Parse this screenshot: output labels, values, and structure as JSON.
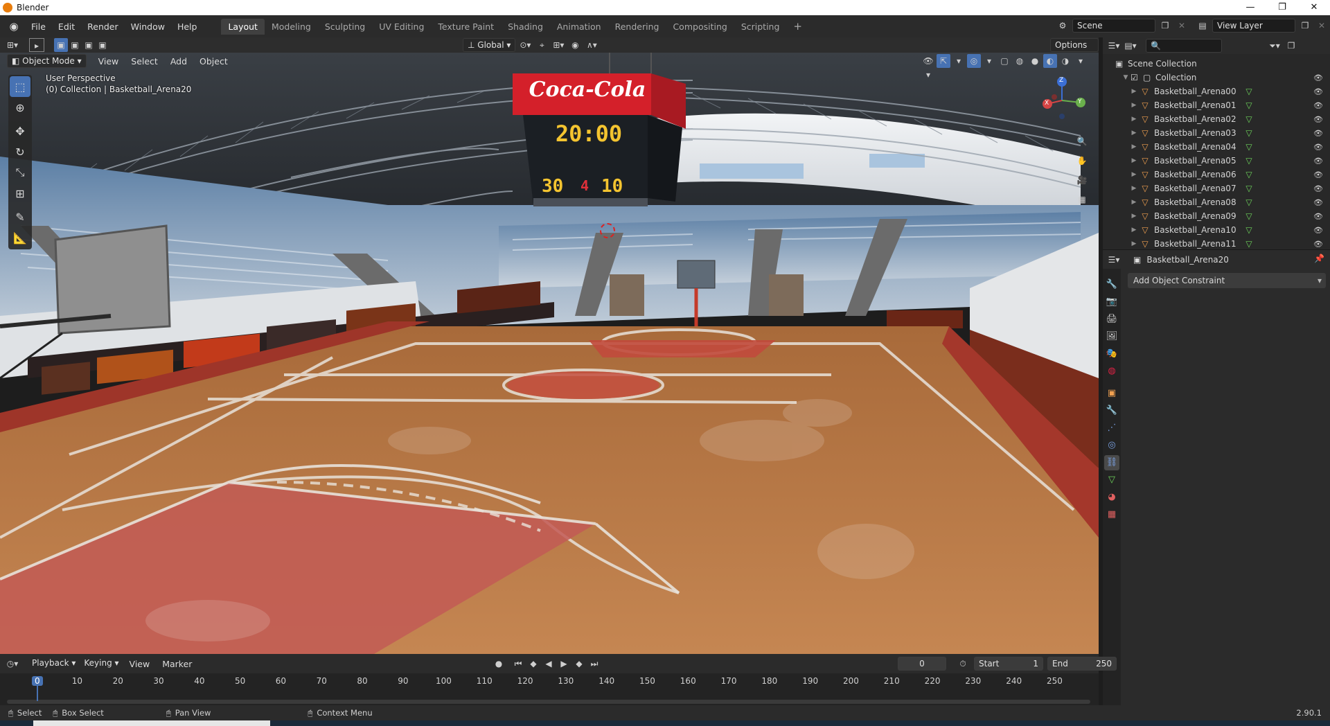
{
  "window": {
    "title": "Blender",
    "buttons": [
      "—",
      "❐",
      "✕"
    ]
  },
  "menu": {
    "items": [
      "File",
      "Edit",
      "Render",
      "Window",
      "Help"
    ]
  },
  "workspaces": {
    "tabs": [
      "Layout",
      "Modeling",
      "Sculpting",
      "UV Editing",
      "Texture Paint",
      "Shading",
      "Animation",
      "Rendering",
      "Compositing",
      "Scripting"
    ],
    "active": "Layout",
    "add": "+"
  },
  "scene": {
    "name": "Scene",
    "view_layer": "View Layer"
  },
  "viewport": {
    "mode": "Object Mode",
    "menus": [
      "View",
      "Select",
      "Add",
      "Object"
    ],
    "orientation": "Global",
    "options_label": "Options",
    "overlay_line1": "User Perspective",
    "overlay_line2": "(0) Collection | Basketball_Arena20",
    "gizmo": {
      "x": "X",
      "y": "Y",
      "z": "Z"
    }
  },
  "scene_image": {
    "scoreboard_brand": "Coca-Cola",
    "scoreboard_time": "20:00",
    "score_left": "30",
    "score_right": "10",
    "period": "4"
  },
  "outliner": {
    "root": "Scene Collection",
    "collection": "Collection",
    "items": [
      "Basketball_Arena00",
      "Basketball_Arena01",
      "Basketball_Arena02",
      "Basketball_Arena03",
      "Basketball_Arena04",
      "Basketball_Arena05",
      "Basketball_Arena06",
      "Basketball_Arena07",
      "Basketball_Arena08",
      "Basketball_Arena09",
      "Basketball_Arena10",
      "Basketball_Arena11"
    ]
  },
  "properties": {
    "object_name": "Basketball_Arena20",
    "constraint_button": "Add Object Constraint"
  },
  "timeline": {
    "menus": [
      "Playback",
      "Keying",
      "View",
      "Marker"
    ],
    "current_frame": "0",
    "start_label": "Start",
    "start_value": "1",
    "end_label": "End",
    "end_value": "250",
    "ticks": [
      "0",
      "10",
      "20",
      "30",
      "40",
      "50",
      "60",
      "70",
      "80",
      "90",
      "100",
      "110",
      "120",
      "130",
      "140",
      "150",
      "160",
      "170",
      "180",
      "190",
      "200",
      "210",
      "220",
      "230",
      "240",
      "250"
    ]
  },
  "statusbar": {
    "select": "Select",
    "box_select": "Box Select",
    "pan_view": "Pan View",
    "context_menu": "Context Menu",
    "version": "2.90.1"
  },
  "colors": {
    "accent": "#4772b3",
    "header": "#2b2b2b",
    "panel": "#303030",
    "object_orange": "#f0a050",
    "mesh_green": "#6ed35b"
  }
}
